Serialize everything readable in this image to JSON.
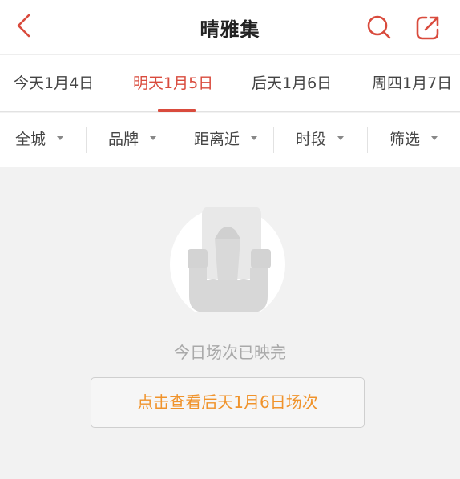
{
  "header": {
    "title": "晴雅集",
    "back_icon": "chevron-left-icon",
    "search_icon": "search-icon",
    "share_icon": "share-icon",
    "accent_color": "#d94b3d"
  },
  "date_tabs": [
    {
      "label": "今天1月4日",
      "active": false
    },
    {
      "label": "明天1月5日",
      "active": true
    },
    {
      "label": "后天1月6日",
      "active": false
    },
    {
      "label": "周四1月7日",
      "active": false
    }
  ],
  "filters": [
    {
      "label": "全城"
    },
    {
      "label": "品牌"
    },
    {
      "label": "距离近"
    },
    {
      "label": "时段"
    },
    {
      "label": "筛选"
    }
  ],
  "empty_state": {
    "illustration_icon": "empty-cinema-seat-icon",
    "message": "今日场次已映完",
    "action_label": "点击查看后天1月6日场次",
    "action_color": "#f0932b"
  }
}
